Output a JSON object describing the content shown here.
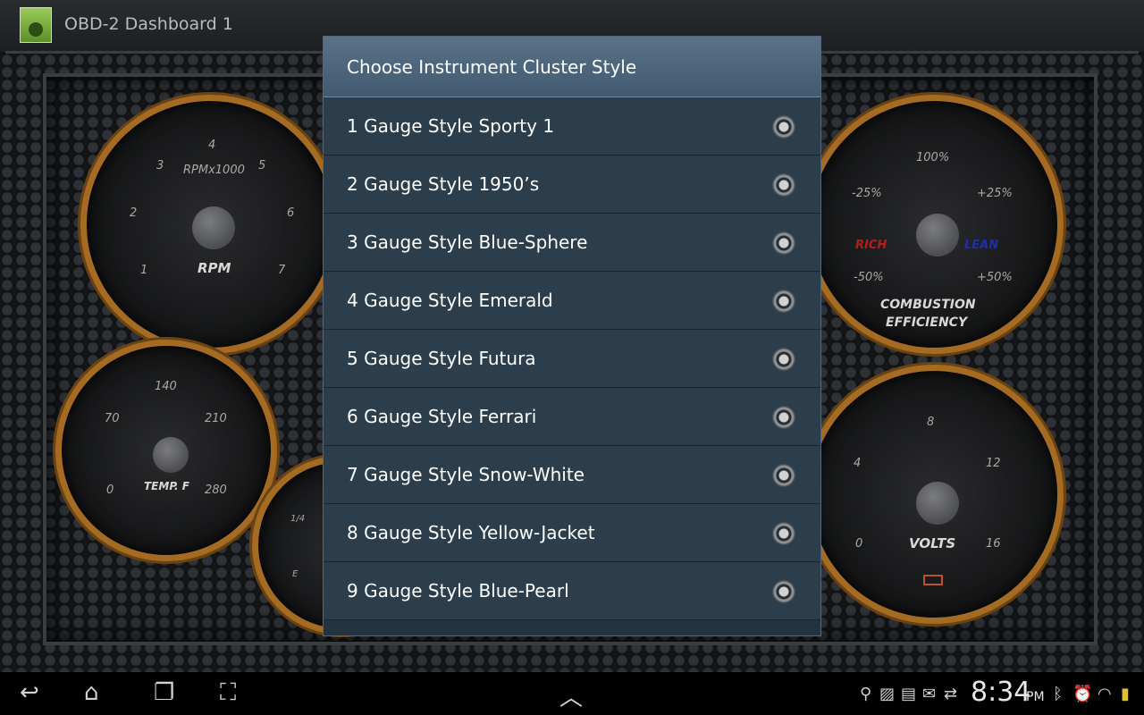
{
  "app": {
    "title": "OBD-2 Dashboard 1"
  },
  "gauges": {
    "rpm": {
      "label": "RPM",
      "unit": "RPMx1000",
      "ticks": [
        "1",
        "2",
        "3",
        "4",
        "5",
        "6",
        "7"
      ]
    },
    "temp": {
      "label": "TEMP. F",
      "ticks": [
        "0",
        "70",
        "140",
        "210",
        "280"
      ]
    },
    "fuel": {
      "ticks": [
        "1/4",
        "E"
      ]
    },
    "combustion": {
      "label": "COMBUSTION EFFICIENCY",
      "label_line1": "COMBUSTION",
      "label_line2": "EFFICIENCY",
      "rich": "RICH",
      "lean": "LEAN",
      "ticks": [
        "100%",
        "-25%",
        "+25%",
        "-50%",
        "+50%"
      ]
    },
    "volts": {
      "label": "VOLTS",
      "ticks": [
        "0",
        "4",
        "8",
        "12",
        "16"
      ]
    }
  },
  "dialog": {
    "title": "Choose Instrument Cluster Style",
    "options": [
      {
        "label": "1 Gauge Style Sporty 1"
      },
      {
        "label": "2 Gauge Style 1950’s"
      },
      {
        "label": "3 Gauge Style Blue-Sphere"
      },
      {
        "label": "4 Gauge Style Emerald"
      },
      {
        "label": "5 Gauge Style Futura"
      },
      {
        "label": "6 Gauge Style Ferrari"
      },
      {
        "label": "7 Gauge Style Snow-White"
      },
      {
        "label": "8 Gauge Style Yellow-Jacket"
      },
      {
        "label": "9 Gauge Style Blue-Pearl"
      }
    ]
  },
  "navbar": {
    "icons": [
      "back-icon",
      "home-icon",
      "recent-apps-icon",
      "screenshot-icon",
      "up-arrow-icon"
    ],
    "status_icons": [
      "usb-icon",
      "gallery-icon",
      "amazon-icon",
      "mail-icon",
      "sync-icon",
      "bluetooth-icon",
      "alarm-icon",
      "wifi-icon",
      "battery-icon"
    ],
    "time": "8:34",
    "ampm": "PM"
  },
  "colors": {
    "dialog_bg": "#2c3d4c",
    "dialog_header": "#4d657b",
    "gauge_rim": "#a66b22"
  }
}
